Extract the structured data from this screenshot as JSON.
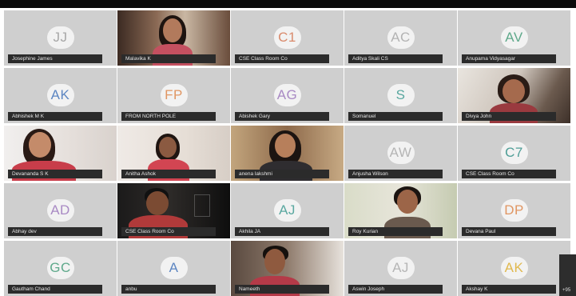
{
  "participants": [
    {
      "name": "Josephine James",
      "initials": "JJ",
      "color": "#a7a7a7",
      "video": false
    },
    {
      "name": "Malavika K",
      "initials": "",
      "color": "",
      "video": true
    },
    {
      "name": "CSE Class Room Co",
      "initials": "C1",
      "color": "#d98a6c",
      "video": false
    },
    {
      "name": "Aditya Skali CS",
      "initials": "AC",
      "color": "#b3b3b3",
      "video": false
    },
    {
      "name": "Anupama Vidyasagar",
      "initials": "AV",
      "color": "#5fa98b",
      "video": false
    },
    {
      "name": "Abhishek M K",
      "initials": "AK",
      "color": "#5d86c2",
      "video": false
    },
    {
      "name": "FROM NORTH POLE",
      "initials": "FP",
      "color": "#e09663",
      "video": false
    },
    {
      "name": "Abishek Gary",
      "initials": "AG",
      "color": "#a98ac4",
      "video": false
    },
    {
      "name": "Somanuel",
      "initials": "S",
      "color": "#5aa8a0",
      "video": false
    },
    {
      "name": "Divya John",
      "initials": "",
      "color": "",
      "video": true
    },
    {
      "name": "Devananda S K",
      "initials": "",
      "color": "",
      "video": true
    },
    {
      "name": "Anitha Ashok",
      "initials": "",
      "color": "",
      "video": true
    },
    {
      "name": "anena lakshmi",
      "initials": "",
      "color": "",
      "video": true
    },
    {
      "name": "Anjusha Wilson",
      "initials": "AW",
      "color": "#b5b5b5",
      "video": false
    },
    {
      "name": "CSE Class Room Co",
      "initials": "C7",
      "color": "#4f9e97",
      "video": false
    },
    {
      "name": "Abhay dev",
      "initials": "AD",
      "color": "#a98ac4",
      "video": false
    },
    {
      "name": "CSE Class Room Co",
      "initials": "",
      "color": "",
      "video": true
    },
    {
      "name": "Akhila JA",
      "initials": "AJ",
      "color": "#5aa8a0",
      "video": false
    },
    {
      "name": "Roy Kurian",
      "initials": "",
      "color": "",
      "video": true
    },
    {
      "name": "Devana Paul",
      "initials": "DP",
      "color": "#e09663",
      "video": false
    },
    {
      "name": "Gautham Chand",
      "initials": "GC",
      "color": "#5fa98b",
      "video": false
    },
    {
      "name": "anbu",
      "initials": "A",
      "color": "#5d86c2",
      "video": false
    },
    {
      "name": "Nameeth",
      "initials": "",
      "color": "",
      "video": true
    },
    {
      "name": "Aswin Joseph",
      "initials": "AJ",
      "color": "#b5b5b5",
      "video": false
    },
    {
      "name": "Akshay K",
      "initials": "AK",
      "color": "#e0b84e",
      "video": false
    }
  ],
  "overflow": {
    "label": "+95"
  }
}
